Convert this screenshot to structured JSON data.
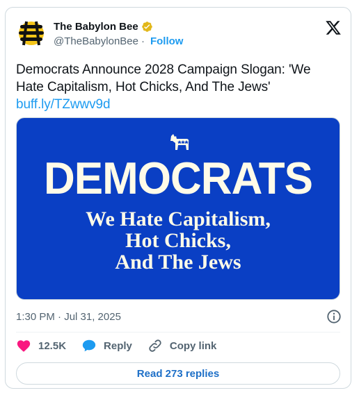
{
  "account": {
    "display_name": "The Babylon Bee",
    "handle": "@TheBabylonBee",
    "separator": "·",
    "follow_label": "Follow",
    "verified_color": "#e2b719"
  },
  "tweet": {
    "text": "Democrats Announce 2028 Campaign Slogan: 'We Hate Capitalism, Hot Chicks, And The Jews'",
    "link": "buff.ly/TZwwv9d",
    "timestamp": "1:30 PM · Jul 31, 2025"
  },
  "media": {
    "headline": "DEMOCRATS",
    "slogan_lines": [
      "We Hate Capitalism,",
      "Hot Chicks,",
      "And The Jews"
    ],
    "background_color": "#0a3fc4"
  },
  "actions": {
    "like_count": "12.5K",
    "reply_label": "Reply",
    "copy_link_label": "Copy link"
  },
  "read_replies_label": "Read 273 replies",
  "colors": {
    "accent": "#1d9bf0",
    "like": "#f91880",
    "secondary_text": "#536471"
  }
}
